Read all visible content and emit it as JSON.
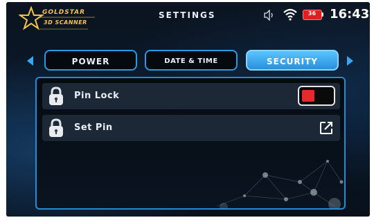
{
  "brand": {
    "line1": "GOLDSTAR",
    "line2": "3D SCANNER",
    "color": "#f4c44a"
  },
  "status_bar": {
    "title": "SETTINGS",
    "battery_level": "36",
    "time": "16:43",
    "icons": [
      "speaker-icon",
      "wifi-icon",
      "battery-icon"
    ]
  },
  "tabs": [
    {
      "label": "POWER",
      "active": false
    },
    {
      "label": "DATE & TIME",
      "active": false
    },
    {
      "label": "SECURITY",
      "active": true
    }
  ],
  "settings": {
    "rows": [
      {
        "label": "Pin Lock",
        "icon": "padlock-icon",
        "control": "toggle",
        "toggle_on": false
      },
      {
        "label": "Set Pin",
        "icon": "padlock-icon",
        "control": "edit-icon"
      }
    ]
  },
  "colors": {
    "accent": "#2a9be0",
    "active_tab": "#3aaaf0",
    "toggle_off": "#e32b2b",
    "row_bg": "#1c2836"
  }
}
